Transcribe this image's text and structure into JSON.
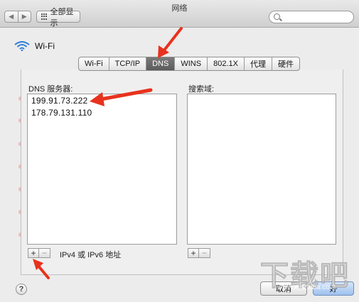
{
  "window": {
    "title": "网络"
  },
  "toolbar": {
    "back_label": "◀",
    "forward_label": "▶",
    "show_all_label": "全部显示"
  },
  "header": {
    "service_name": "Wi-Fi"
  },
  "tabs": [
    {
      "label": "Wi-Fi",
      "active": false
    },
    {
      "label": "TCP/IP",
      "active": false
    },
    {
      "label": "DNS",
      "active": true
    },
    {
      "label": "WINS",
      "active": false
    },
    {
      "label": "802.1X",
      "active": false
    },
    {
      "label": "代理",
      "active": false
    },
    {
      "label": "硬件",
      "active": false
    }
  ],
  "dns": {
    "servers_label": "DNS 服务器:",
    "servers": [
      "199.91.73.222",
      "178.79.131.110"
    ],
    "add_label": "+",
    "remove_label": "−",
    "hint": "IPv4 或 IPv6 地址"
  },
  "search_domains": {
    "label": "搜索域:",
    "add_label": "+",
    "remove_label": "−"
  },
  "footer": {
    "help_label": "?",
    "cancel_label": "取消",
    "ok_label": "好"
  },
  "colors": {
    "annotation": "#e8321e",
    "active_tab": "#666666",
    "default_button": "#9ec1ee"
  },
  "watermark": {
    "text": "下载吧",
    "sub": "www.xiazaiba.com"
  }
}
